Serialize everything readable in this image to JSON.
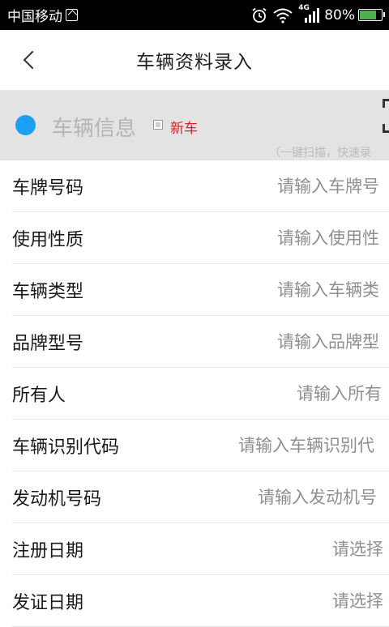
{
  "status_bar": {
    "carrier": "中国移动",
    "network_badge": "4G",
    "battery_percent": "80%",
    "battery_level": 0.8,
    "icons": [
      "picture-icon",
      "alarm-icon",
      "wifi-icon",
      "signal-icon",
      "battery-icon"
    ]
  },
  "nav": {
    "title": "车辆资料录入",
    "back_icon": "chevron-left-icon"
  },
  "section": {
    "title": "车辆信息",
    "new_car_label": "新车",
    "scan_hint": "（一键扫描，快速录",
    "accent_color": "#1ca1f2",
    "new_car_color": "#e02020"
  },
  "form": {
    "rows": [
      {
        "label": "车牌号码",
        "placeholder": "请输入车牌号"
      },
      {
        "label": "使用性质",
        "placeholder": "请输入使用性"
      },
      {
        "label": "车辆类型",
        "placeholder": "请输入车辆类"
      },
      {
        "label": "品牌型号",
        "placeholder": "请输入品牌型"
      },
      {
        "label": "所有人",
        "placeholder": "请输入所有"
      },
      {
        "label": "车辆识别代码",
        "placeholder": "请输入车辆识别代"
      },
      {
        "label": "发动机号码",
        "placeholder": "请输入发动机号"
      },
      {
        "label": "注册日期",
        "placeholder": "请选择"
      },
      {
        "label": "发证日期",
        "placeholder": "请选择"
      }
    ]
  }
}
